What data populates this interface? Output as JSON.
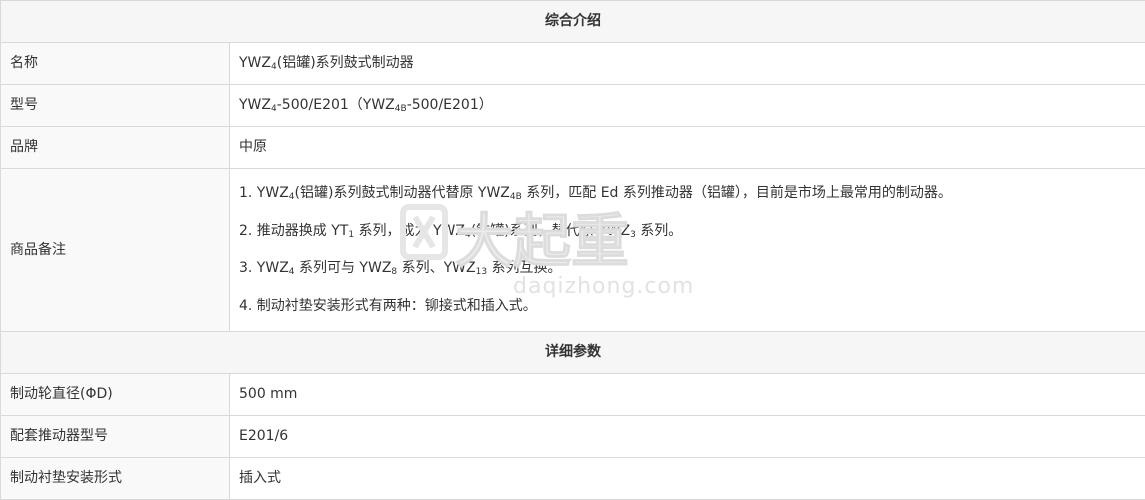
{
  "sections": {
    "intro_title": "综合介绍",
    "detail_title": "详细参数"
  },
  "rows": {
    "name": {
      "label": "名称",
      "value_pre": "YWZ",
      "value_sub": "4",
      "value_post": "(铝罐)系列鼓式制动器"
    },
    "model": {
      "label": "型号",
      "p1": "YWZ",
      "s1": "4",
      "p2": "-500/E201（YWZ",
      "s2": "4B",
      "p3": "-500/E201）"
    },
    "brand": {
      "label": "品牌",
      "value": "中原"
    },
    "notes": {
      "label": "商品备注",
      "line1": {
        "p1": "1. YWZ",
        "s1": "4",
        "p2": "(铝罐)系列鼓式制动器代替原 YWZ",
        "s2": "4B",
        "p3": " 系列，匹配 Ed 系列推动器（铝罐），目前是市场上最常用的制动器。"
      },
      "line2": {
        "p1": "2.  推动器换成 YT",
        "s1": "1",
        "p2": " 系列，成为 YWZ",
        "s2": "4",
        "p3": "(铁罐)系列，替代原 YWZ",
        "s3": "3",
        "p4": " 系列。"
      },
      "line3": {
        "p1": "3. YWZ",
        "s1": "4",
        "p2": " 系列可与 YWZ",
        "s2": "8",
        "p3": " 系列、YWZ",
        "s3": "13",
        "p4": " 系列互换。"
      },
      "line4": {
        "p1": "4.  制动衬垫安装形式有两种：铆接式和插入式。"
      }
    },
    "diameter": {
      "label": "制动轮直径(ΦD)",
      "value": "500 mm"
    },
    "pusher": {
      "label": "配套推动器型号",
      "value": "E201/6"
    },
    "pad": {
      "label": "制动衬垫安装形式",
      "value": "插入式"
    }
  },
  "watermark": {
    "main_text": "大起重",
    "url_text": "daqizhong.com"
  }
}
